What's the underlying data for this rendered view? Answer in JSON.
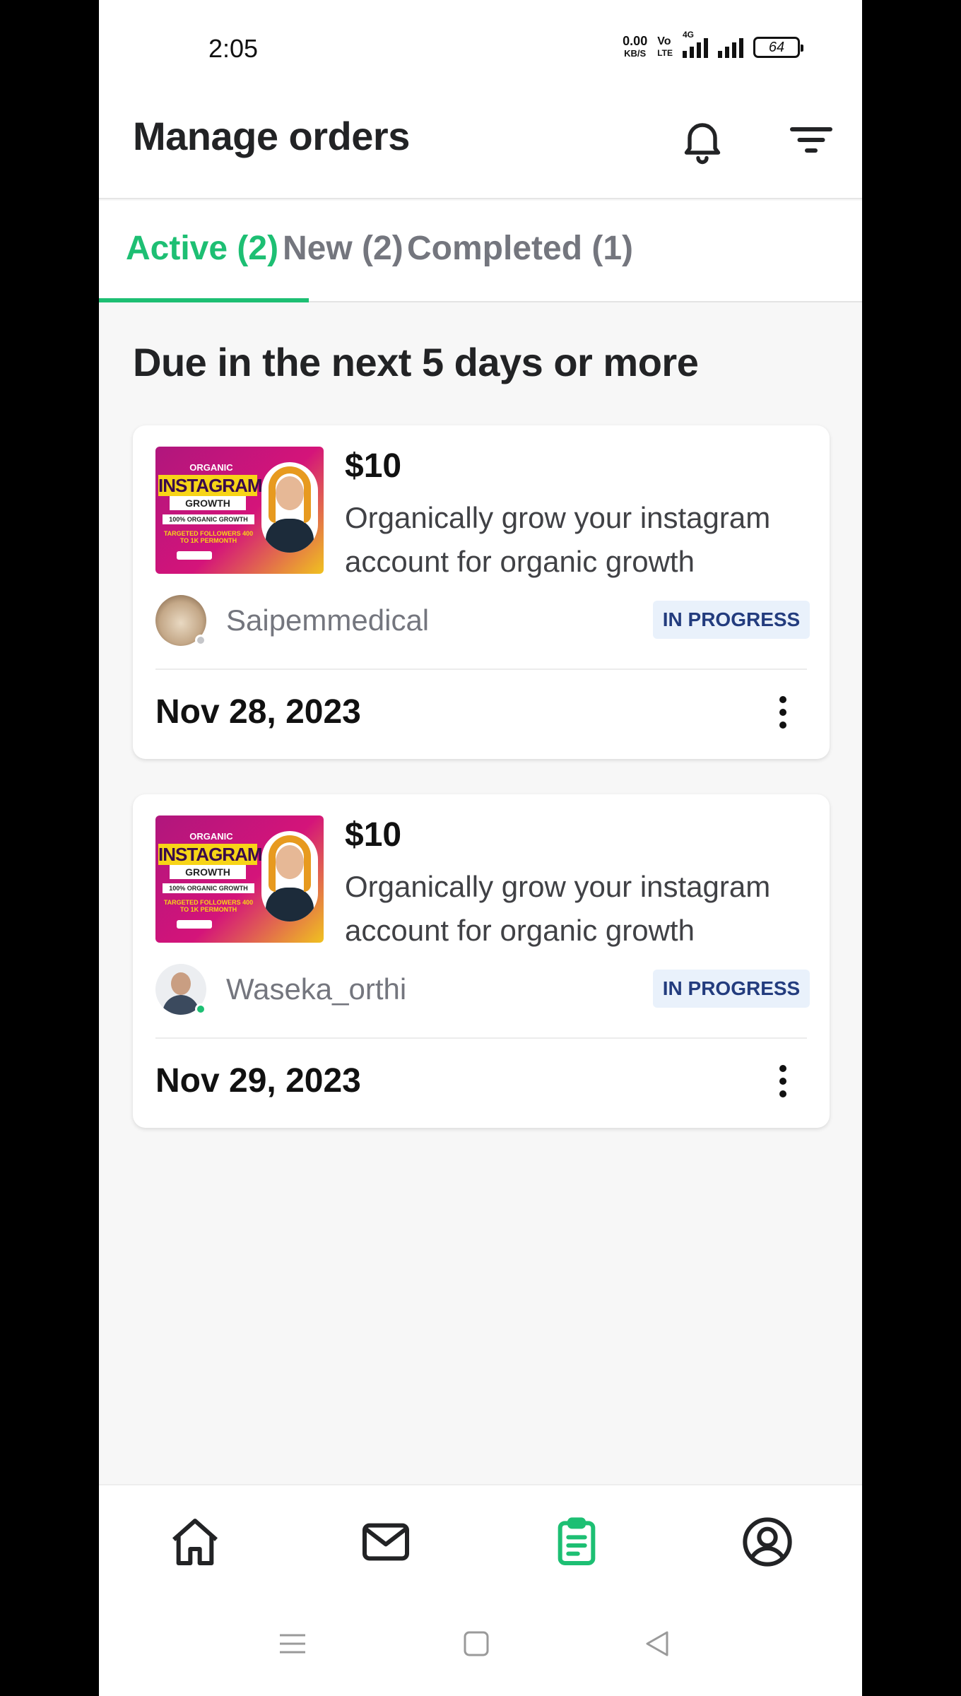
{
  "status_bar": {
    "time": "2:05",
    "net_speed_value": "0.00",
    "net_speed_unit": "KB/S",
    "volte_top": "Vo",
    "volte_bottom": "LTE",
    "network_type": "4G",
    "battery": "64"
  },
  "header": {
    "title": "Manage orders",
    "icons": [
      "bell-icon",
      "filter-icon"
    ]
  },
  "tabs": [
    {
      "label": "Active (2)",
      "active": true
    },
    {
      "label": "New (2)",
      "active": false
    },
    {
      "label": "Completed (1)",
      "active": false
    }
  ],
  "section_title": "Due in the next 5 days or more",
  "orders": [
    {
      "price": "$10",
      "description": "Organically grow your instagram account for organic growth",
      "username": "Saipemmedical",
      "online": false,
      "status": "IN PROGRESS",
      "due_date": "Nov 28, 2023",
      "thumbnail": {
        "line1": "ORGANIC",
        "line2": "INSTAGRAM",
        "line3": "GROWTH",
        "line4": "100% ORGANIC GROWTH",
        "line5": "TARGETED FOLLOWERS 400 TO 1K PERMONTH"
      }
    },
    {
      "price": "$10",
      "description": "Organically grow your instagram account for organic growth",
      "username": "Waseka_orthi",
      "online": true,
      "status": "IN PROGRESS",
      "due_date": "Nov 29, 2023",
      "thumbnail": {
        "line1": "ORGANIC",
        "line2": "INSTAGRAM",
        "line3": "GROWTH",
        "line4": "100% ORGANIC GROWTH",
        "line5": "TARGETED FOLLOWERS 400 TO 1K PERMONTH"
      }
    }
  ],
  "bottom_nav": [
    {
      "icon": "home-icon",
      "active": false
    },
    {
      "icon": "inbox-icon",
      "active": false
    },
    {
      "icon": "orders-icon",
      "active": true
    },
    {
      "icon": "profile-icon",
      "active": false
    }
  ],
  "colors": {
    "accent": "#1dbf73",
    "badge_bg": "#e9f1fb",
    "badge_text": "#233c7e"
  }
}
